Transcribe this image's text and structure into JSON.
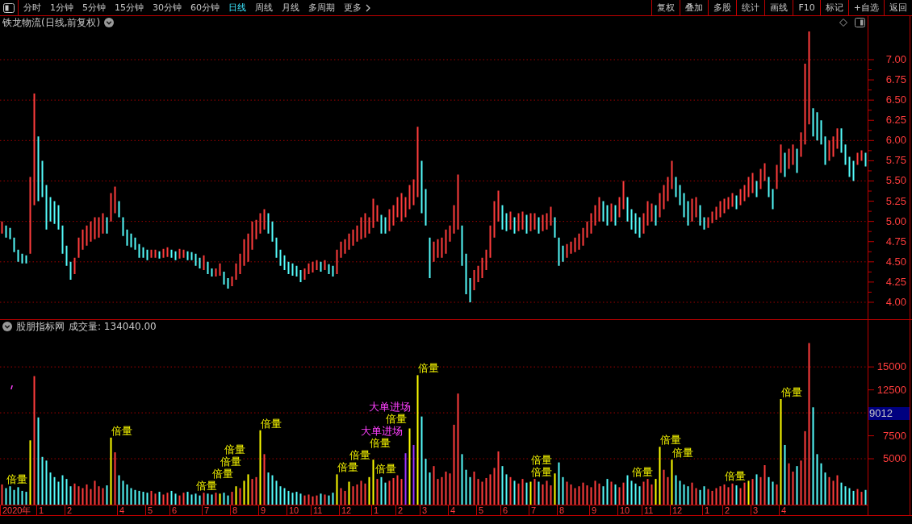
{
  "toolbar": {
    "periods": [
      {
        "label": "分时",
        "selected": false
      },
      {
        "label": "1分钟",
        "selected": false
      },
      {
        "label": "5分钟",
        "selected": false
      },
      {
        "label": "15分钟",
        "selected": false
      },
      {
        "label": "30分钟",
        "selected": false
      },
      {
        "label": "60分钟",
        "selected": false
      },
      {
        "label": "日线",
        "selected": true
      },
      {
        "label": "周线",
        "selected": false
      },
      {
        "label": "月线",
        "selected": false
      },
      {
        "label": "多周期",
        "selected": false
      }
    ],
    "more": "更多",
    "buttons": [
      "复权",
      "叠加",
      "多股",
      "统计",
      "画线",
      "F10",
      "标记",
      "+自选",
      "返回"
    ]
  },
  "price_panel": {
    "title": "铁龙物流(日线,前复权)",
    "axis_labels": [
      "7.00",
      "6.75",
      "6.50",
      "6.25",
      "6.00",
      "5.75",
      "5.50",
      "5.25",
      "5.00",
      "4.75",
      "4.50",
      "4.25",
      "4.00"
    ]
  },
  "volume_panel": {
    "source": "股朋指标网",
    "title": "成交量: 134040.00",
    "readout": "9012",
    "chart_data": {
      "type": "bar",
      "ylim": [
        0,
        18700
      ],
      "yticks": [
        5000,
        7500,
        12500,
        15000
      ],
      "values": [
        2200,
        1800,
        2000,
        1600,
        1900,
        1500,
        1400,
        7000,
        14000,
        9500,
        5200,
        4800,
        3500,
        3000,
        2500,
        3200,
        2800,
        2000,
        2300,
        2000,
        1800,
        2200,
        1700,
        2600,
        2000,
        1800,
        2100,
        7300,
        5700,
        3200,
        2600,
        2200,
        1800,
        1600,
        1500,
        1400,
        1300,
        1500,
        1200,
        1400,
        1100,
        1300,
        1500,
        1200,
        1000,
        1300,
        1400,
        1100,
        1200,
        1000,
        1300,
        1200,
        1100,
        1300,
        1200,
        1300,
        1000,
        1400,
        2000,
        1800,
        2600,
        3300,
        2800,
        3000,
        8100,
        5500,
        3500,
        3200,
        2600,
        2000,
        1800,
        1500,
        1300,
        1400,
        1200,
        1000,
        1100,
        900,
        1000,
        1200,
        1100,
        1000,
        1300,
        3300,
        1800,
        1500,
        2500,
        2000,
        2200,
        2600,
        2300,
        3000,
        4900,
        2800,
        3000,
        2400,
        2600,
        2900,
        3200,
        2800,
        5600,
        8300,
        6500,
        14100,
        9600,
        5000,
        3500,
        4200,
        2800,
        3000,
        3600,
        3400,
        8700,
        12100,
        5500,
        3800,
        3000,
        3600,
        2800,
        2500,
        2900,
        3300,
        4000,
        5800,
        4200,
        3300,
        3000,
        2600,
        2300,
        2800,
        2400,
        2500,
        2800,
        2500,
        2200,
        2600,
        2100,
        3400,
        4600,
        3000,
        2500,
        2200,
        1800,
        2000,
        2400,
        2100,
        1900,
        2600,
        2300,
        2000,
        2800,
        2500,
        2200,
        1900,
        2400,
        3200,
        2600,
        2300,
        2000,
        2500,
        2800,
        2200,
        2800,
        6300,
        3800,
        3000,
        4900,
        3200,
        2600,
        2200,
        2000,
        2400,
        1800,
        1600,
        2000,
        1700,
        1500,
        1800,
        2000,
        2200,
        1900,
        2300,
        2100,
        1800,
        2400,
        2600,
        2800,
        3300,
        3000,
        4300,
        3000,
        2500,
        2200,
        11500,
        6500,
        4500,
        3600,
        4200,
        4800,
        8000,
        17600,
        10600,
        5500,
        4500,
        3500,
        3000,
        2600,
        3200,
        2400,
        2000,
        1800,
        1500,
        1700,
        1400,
        1600
      ]
    },
    "signals": [
      {
        "label": "倍量",
        "kind": "double"
      },
      {
        "label": "倍量",
        "kind": "double"
      },
      {
        "label": "倍量",
        "kind": "double"
      },
      {
        "label": "倍量",
        "kind": "double"
      },
      {
        "label": "倍量",
        "kind": "double"
      },
      {
        "label": "倍量",
        "kind": "double"
      },
      {
        "label": "倍量",
        "kind": "double"
      },
      {
        "label": "倍量",
        "kind": "double"
      },
      {
        "label": "大单进场",
        "kind": "inflow"
      },
      {
        "label": "倍量",
        "kind": "double"
      },
      {
        "label": "大单进场",
        "kind": "inflow"
      },
      {
        "label": "倍量",
        "kind": "double"
      },
      {
        "label": "倍量",
        "kind": "double"
      },
      {
        "label": "倍量",
        "kind": "double"
      },
      {
        "label": "倍量",
        "kind": "double"
      },
      {
        "label": "倍量",
        "kind": "double"
      },
      {
        "label": "倍量",
        "kind": "double"
      },
      {
        "label": "倍量",
        "kind": "double"
      },
      {
        "label": "倍量",
        "kind": "double"
      },
      {
        "label": "倍量",
        "kind": "double"
      },
      {
        "label": "倍量",
        "kind": "double"
      },
      {
        "label": "倍量",
        "kind": "double"
      }
    ],
    "x_axis": [
      "2020年",
      "1",
      "2",
      "4",
      "5",
      "6",
      "7",
      "8",
      "9",
      "10",
      "11",
      "12",
      "1",
      "2",
      "3",
      "4",
      "5",
      "6",
      "7",
      "8",
      "9",
      "10",
      "11",
      "12",
      "1",
      "2",
      "3",
      "4"
    ]
  }
}
